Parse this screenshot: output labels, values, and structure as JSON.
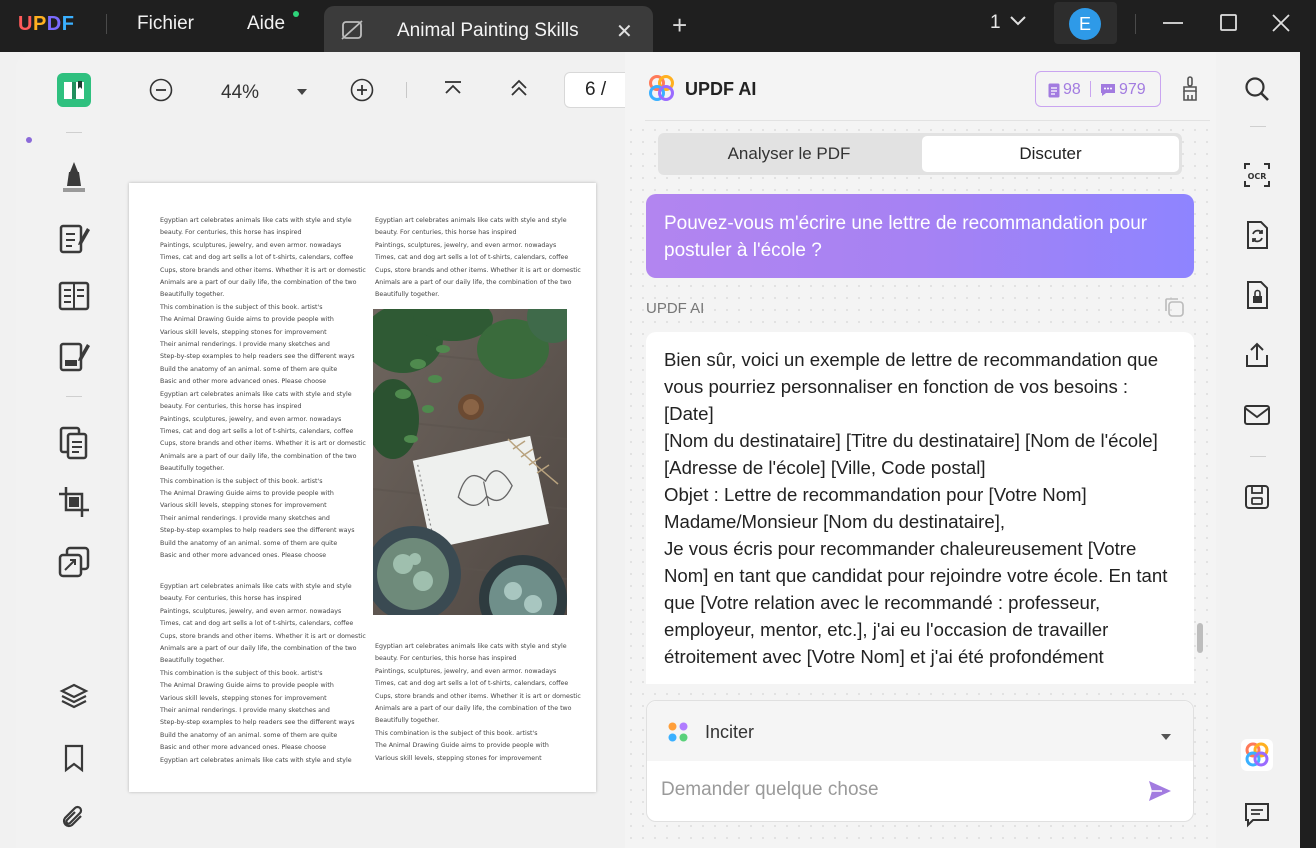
{
  "app": {
    "logo": "UPDF",
    "menu": [
      "Fichier",
      "Aide"
    ],
    "tab_title": "Animal Painting Skills",
    "tab_close": "✕",
    "new_tab": "+",
    "page_indicator": "1",
    "avatar_letter": "E"
  },
  "toolbar": {
    "zoom": "44%",
    "page_input": "6 /"
  },
  "document": {
    "col1_a": [
      "Egyptian art celebrates animals like cats with style and style",
      "beauty. For centuries, this horse has inspired",
      "Paintings, sculptures, jewelry, and even armor. nowadays",
      "Times, cat and dog art sells a lot of t-shirts, calendars, coffee",
      "Cups, store brands and other items. Whether it is art or domestic",
      "Animals are a part of our daily life, the combination of the two",
      "Beautifully together.",
      "This combination is the subject of this book. artist's",
      "The Animal Drawing Guide aims to provide people with",
      "Various skill levels, stepping stones for improvement",
      "Their animal renderings. I provide many sketches and",
      "Step-by-step examples to help readers see the different ways",
      "Build the anatomy of an animal. some of them are quite",
      "Basic and other more advanced ones. Please choose",
      "Egyptian art celebrates animals like cats with style and style",
      "beauty. For centuries, this horse has inspired",
      "Paintings, sculptures, jewelry, and even armor. nowadays",
      "Times, cat and dog art sells a lot of t-shirts, calendars, coffee",
      "Cups, store brands and other items. Whether it is art or domestic",
      "Animals are a part of our daily life, the combination of the two",
      "Beautifully together.",
      "This combination is the subject of this book. artist's",
      "The Animal Drawing Guide aims to provide people with",
      "Various skill levels, stepping stones for improvement",
      "Their animal renderings. I provide many sketches and",
      "Step-by-step examples to help readers see the different ways",
      "Build the anatomy of an animal. some of them are quite",
      "Basic and other more advanced ones. Please choose"
    ],
    "col1_b": [
      "Egyptian art celebrates animals like cats with style and style",
      "beauty. For centuries, this horse has inspired",
      "Paintings, sculptures, jewelry, and even armor. nowadays",
      "Times, cat and dog art sells a lot of t-shirts, calendars, coffee",
      "Cups, store brands and other items. Whether it is art or domestic",
      "Animals are a part of our daily life, the combination of the two",
      "Beautifully together.",
      "This combination is the subject of this book. artist's",
      "The Animal Drawing Guide aims to provide people with",
      "Various skill levels, stepping stones for improvement",
      "Their animal renderings. I provide many sketches and",
      "Step-by-step examples to help readers see the different ways",
      "Build the anatomy of an animal. some of them are quite",
      "Basic and other more advanced ones. Please choose",
      "Egyptian art celebrates animals like cats with style and style"
    ],
    "col2_a": [
      "Egyptian art celebrates animals like cats with style and style",
      "beauty. For centuries, this horse has inspired",
      "Paintings, sculptures, jewelry, and even armor. nowadays",
      "Times, cat and dog art sells a lot of t-shirts, calendars, coffee",
      "Cups, store brands and other items. Whether it is art or domestic",
      "Animals are a part of our daily life, the combination of the two",
      "Beautifully together."
    ],
    "col2_b": [
      "Egyptian art celebrates animals like cats with style and style",
      "beauty. For centuries, this horse has inspired",
      "Paintings, sculptures, jewelry, and even armor. nowadays",
      "Times, cat and dog art sells a lot of t-shirts, calendars, coffee",
      "Cups, store brands and other items. Whether it is art or domestic",
      "Animals are a part of our daily life, the combination of the two",
      "Beautifully together.",
      "This combination is the subject of this book. artist's",
      "The Animal Drawing Guide aims to provide people with",
      "Various skill levels, stepping stones for improvement"
    ]
  },
  "ai": {
    "title": "UPDF AI",
    "credits_docs": "98",
    "credits_chats": "979",
    "tabs": [
      "Analyser le PDF",
      "Discuter"
    ],
    "active_tab": "Discuter",
    "user_message": "Pouvez-vous m'écrire une lettre de recommandation pour postuler à l'école ?",
    "assistant_label": "UPDF AI",
    "response_lines": [
      "Bien sûr, voici un exemple de lettre de recommandation que vous pourriez personnaliser en fonction de vos besoins :",
      "[Date]",
      "[Nom du destinataire] [Titre du destinataire] [Nom de l'école] [Adresse de l'école] [Ville, Code postal]",
      "Objet : Lettre de recommandation pour [Votre Nom]",
      "Madame/Monsieur [Nom du destinataire],",
      "Je vous écris pour recommander chaleureusement [Votre Nom] en tant que candidat pour rejoindre votre école. En tant que [Votre relation avec le recommandé : professeur, employeur, mentor, etc.], j'ai eu l'occasion de travailler étroitement avec [Votre Nom] et j'ai été profondément"
    ],
    "prompt_label": "Inciter",
    "input_placeholder": "Demander quelque chose"
  },
  "colors": {
    "accent": "#8e84ff",
    "user_bubble_start": "#b285f0",
    "user_bubble_end": "#8e84ff",
    "rail_icon": "#3a3a3a",
    "highlight_icon": "#2fc07f"
  }
}
